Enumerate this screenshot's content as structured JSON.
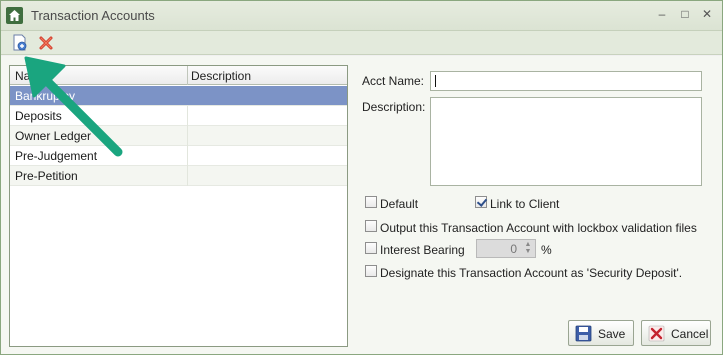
{
  "window": {
    "title": "Transaction Accounts",
    "minimize_label": "–",
    "maximize_label": "□",
    "close_label": "✕"
  },
  "toolbar": {
    "add_icon": "new-document-icon",
    "delete_icon": "delete-x-icon"
  },
  "grid": {
    "columns": [
      "Name",
      "Description"
    ],
    "rows": [
      {
        "name": "Bankruptcy",
        "description": "",
        "selected": true
      },
      {
        "name": "Deposits",
        "description": "",
        "selected": false
      },
      {
        "name": "Owner Ledger",
        "description": "",
        "selected": false
      },
      {
        "name": "Pre-Judgement",
        "description": "",
        "selected": false
      },
      {
        "name": "Pre-Petition",
        "description": "",
        "selected": false
      }
    ]
  },
  "form": {
    "acct_name_label": "Acct Name:",
    "acct_name_value": "",
    "description_label": "Description:",
    "description_value": "",
    "default_label": "Default",
    "default_checked": false,
    "link_to_client_label": "Link to Client",
    "link_to_client_checked": true,
    "lockbox_label": "Output this Transaction Account with lockbox validation files",
    "lockbox_checked": false,
    "interest_label": "Interest Bearing",
    "interest_checked": false,
    "interest_value": "0",
    "interest_unit": "%",
    "security_deposit_label": "Designate this Transaction Account as 'Security Deposit'.",
    "security_deposit_checked": false
  },
  "buttons": {
    "save_label": "Save",
    "cancel_label": "Cancel"
  },
  "colors": {
    "selection": "#7c93c6",
    "annotation_arrow": "#1aa57f",
    "titlebar": "#dbe3d3"
  }
}
